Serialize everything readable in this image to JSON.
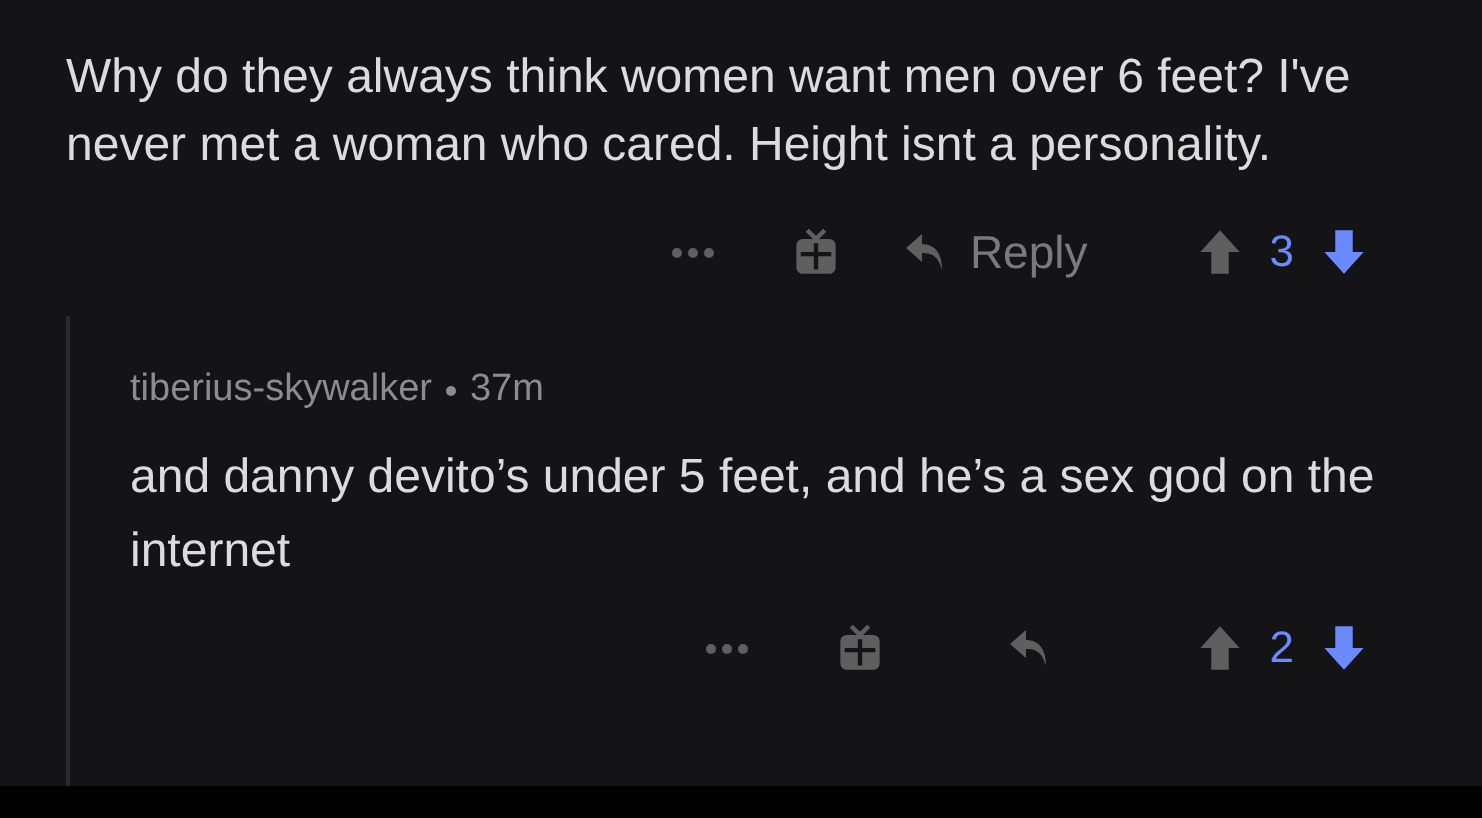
{
  "comment": {
    "body": "Why do they always think women want men over 6 feet? I've never met a woman who cared. Height isnt a personality.",
    "actions": {
      "reply_label": "Reply",
      "score": "3",
      "upvoted": false,
      "downvoted": true
    }
  },
  "reply": {
    "author": "tiberius-skywalker",
    "time": "37m",
    "body": "and danny devito’s under 5 feet, and he’s a sex god on the internet",
    "actions": {
      "score": "2",
      "upvoted": false,
      "downvoted": true
    }
  }
}
